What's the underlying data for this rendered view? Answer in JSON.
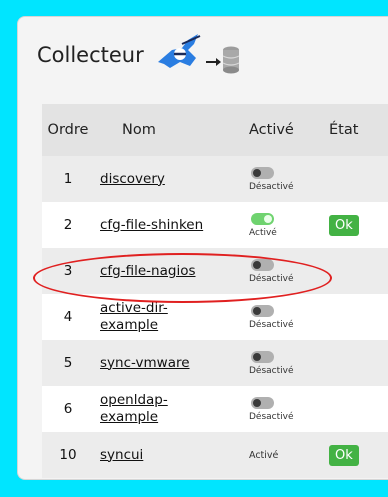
{
  "header": {
    "title": "Collecteur"
  },
  "table": {
    "headers": {
      "ordre": "Ordre",
      "nom": "Nom",
      "active": "Activé",
      "etat": "État"
    },
    "rows": [
      {
        "ordre": "1",
        "nom": "discovery",
        "active": "Désactivé",
        "etat": ""
      },
      {
        "ordre": "2",
        "nom": "cfg-file-shinken",
        "active": "Activé",
        "etat": "Ok"
      },
      {
        "ordre": "3",
        "nom": "cfg-file-nagios",
        "active": "Désactivé",
        "etat": ""
      },
      {
        "ordre": "4",
        "nom": "active-dir-example",
        "active": "Désactivé",
        "etat": ""
      },
      {
        "ordre": "5",
        "nom": "sync-vmware",
        "active": "Désactivé",
        "etat": ""
      },
      {
        "ordre": "6",
        "nom": "openldap-example",
        "active": "Désactivé",
        "etat": ""
      },
      {
        "ordre": "10",
        "nom": "syncui",
        "active": "Activé",
        "etat": "Ok"
      }
    ]
  },
  "colors": {
    "background": "#00e5ff",
    "ok": "#43b244",
    "highlight": "#e02020",
    "toggle_on": "#6fd36f"
  }
}
